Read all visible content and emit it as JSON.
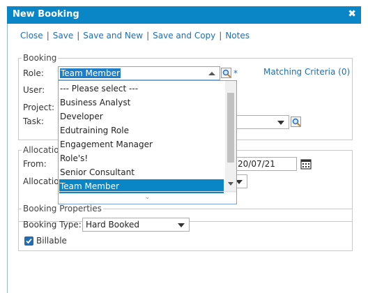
{
  "window": {
    "title": "New Booking",
    "close_glyph": "✖"
  },
  "toolbar": {
    "close": "Close",
    "save": "Save",
    "save_and_new": "Save and New",
    "save_and_copy": "Save and Copy",
    "notes": "Notes"
  },
  "booking": {
    "legend": "Booking",
    "role_label": "Role:",
    "role_value": "Team Member",
    "required_mark": "*",
    "matching_criteria": "Matching Criteria (0)",
    "user_label": "User:",
    "project_label": "Project:",
    "task_label": "Task:"
  },
  "role_dropdown": {
    "options": [
      "--- Please select ---",
      "Business Analyst",
      "Developer",
      "Edutraining Role",
      "Engagement Manager",
      "Role's!",
      "Senior Consultant",
      "Team Member"
    ],
    "selected": "Team Member",
    "more_glyph": "⌄"
  },
  "allocation": {
    "legend": "Allocatio",
    "from_label": "From:",
    "to_date": "20/07/21",
    "allocation_label": "Allocatio"
  },
  "booking_properties": {
    "legend": "Booking Properties",
    "type_label": "Booking Type:",
    "type_value": "Hard Booked",
    "billable_label": "Billable",
    "billable_checked": true
  },
  "icons": {
    "lookup": "magnifier-icon",
    "calendar": "calendar-icon",
    "checkmark": "check-icon"
  },
  "colors": {
    "titlebar": "#0a85c6",
    "link": "#1f6db5",
    "selected": "#0a85c6"
  }
}
